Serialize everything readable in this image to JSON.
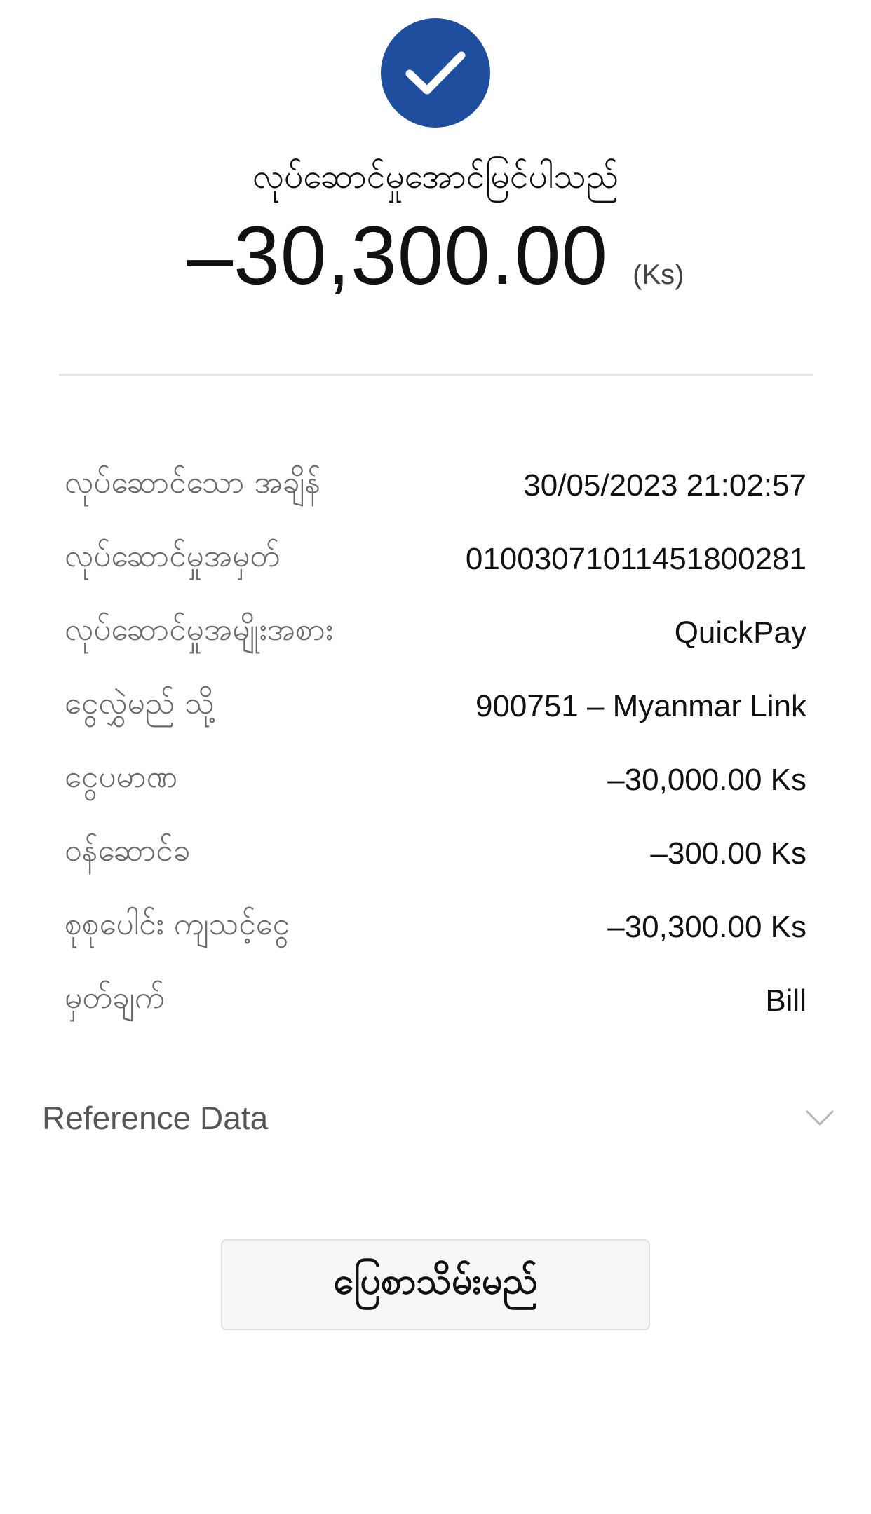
{
  "header": {
    "status_icon": "check-icon",
    "status_text": "လုပ်ဆောင်မှုအောင်မြင်ပါသည်",
    "amount": "–30,300.00",
    "amount_unit": "(Ks)"
  },
  "colors": {
    "accent": "#1f4e9f",
    "label_text": "#6b6b6b",
    "value_text": "#111111",
    "divider": "#e6e6e6",
    "button_bg": "#f6f6f6"
  },
  "details": [
    {
      "label": "လုပ်ဆောင်သော အချိန်",
      "value": "30/05/2023 21:02:57"
    },
    {
      "label": "လုပ်ဆောင်မှုအမှတ်",
      "value": "01003071011451800281"
    },
    {
      "label": "လုပ်ဆောင်မှုအမျိုးအစား",
      "value": "QuickPay"
    },
    {
      "label": "ငွေလွှဲမည် သို့",
      "value": "900751 – Myanmar Link"
    },
    {
      "label": "ငွေပမာဏ",
      "value": "–30,000.00 Ks"
    },
    {
      "label": "ဝန်ဆောင်ခ",
      "value": "–300.00 Ks"
    },
    {
      "label": "စုစုပေါင်း ကျသင့်ငွေ",
      "value": "–30,300.00 Ks"
    },
    {
      "label": "မှတ်ချက်",
      "value": "Bill"
    }
  ],
  "reference": {
    "label": "Reference Data",
    "icon": "chevron-down-icon"
  },
  "actions": {
    "save_label": "ပြေစာသိမ်းမည်"
  }
}
